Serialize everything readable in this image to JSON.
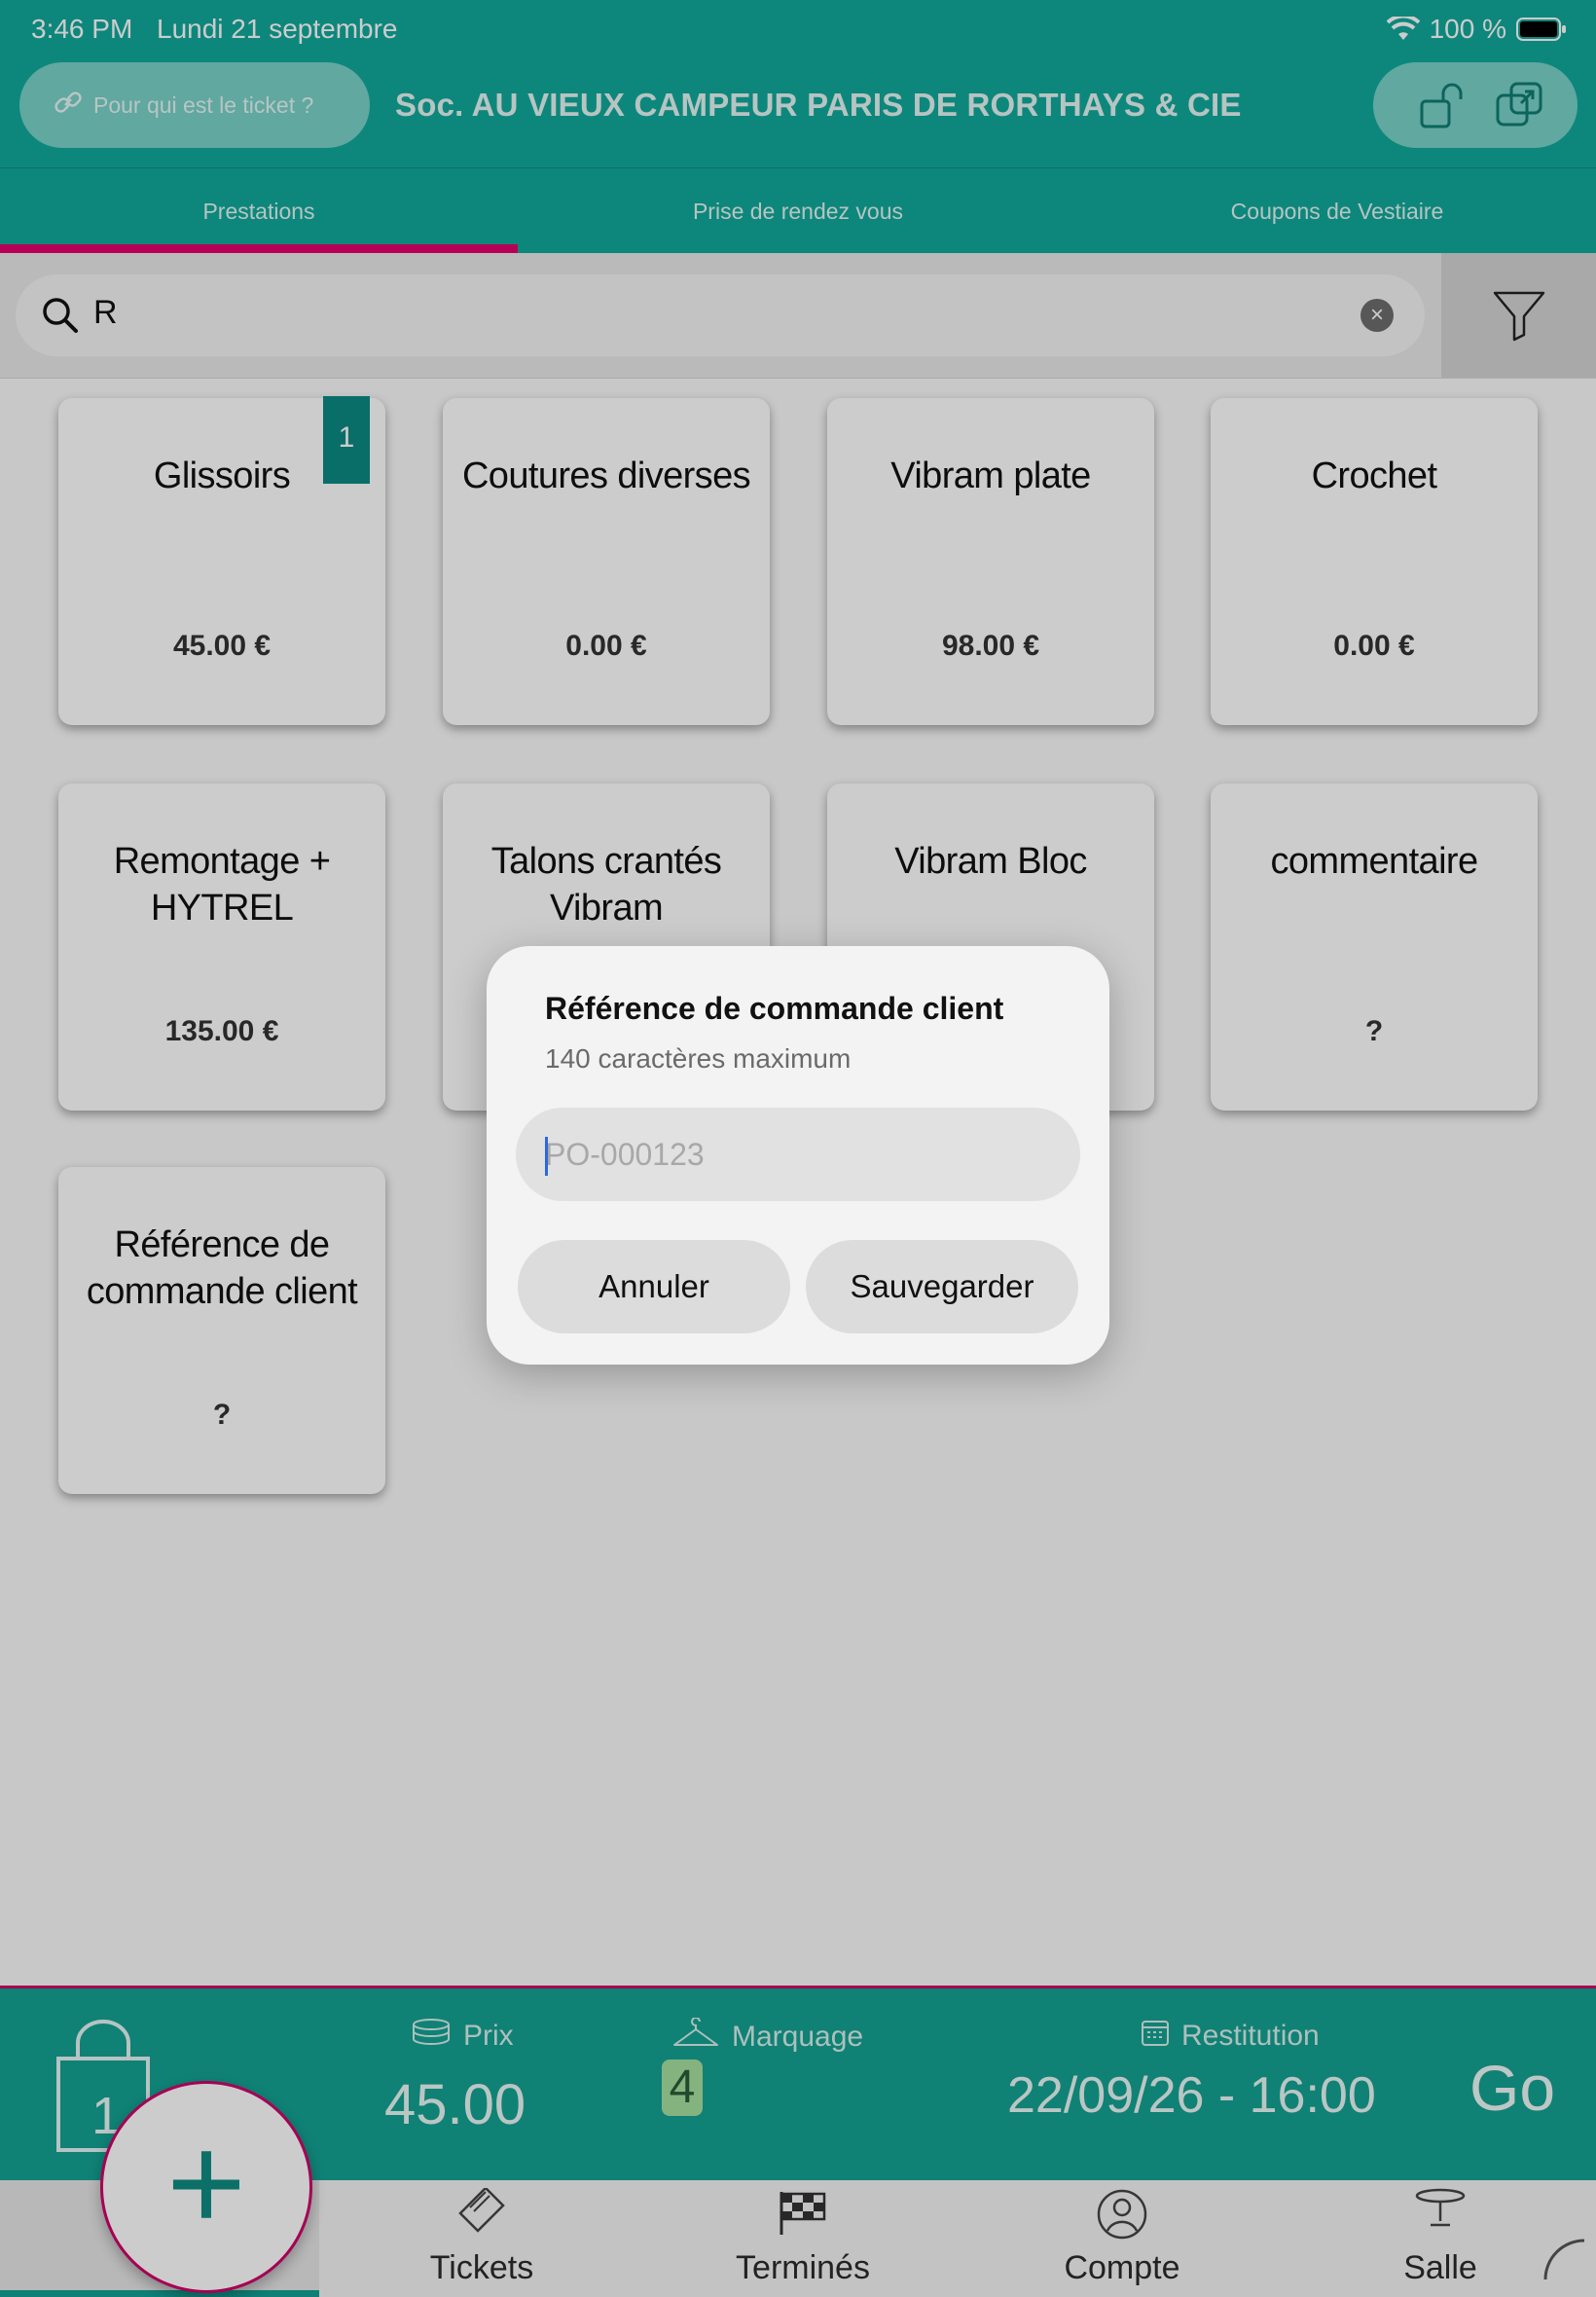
{
  "status_bar": {
    "time": "3:46 PM",
    "date": "Lundi 21 septembre",
    "battery": "100 %"
  },
  "header": {
    "ticket_placeholder": "Pour qui est le ticket ?",
    "company": "Soc. AU VIEUX CAMPEUR PARIS DE RORTHAYS & CIE"
  },
  "tabs": [
    {
      "label": "Prestations",
      "active": true
    },
    {
      "label": "Prise de rendez vous",
      "active": false
    },
    {
      "label": "Coupons de Vestiaire",
      "active": false
    }
  ],
  "search": {
    "value": "R"
  },
  "cards": [
    {
      "name": "Glissoirs",
      "price": "45.00 €",
      "badge": "1"
    },
    {
      "name": "Coutures diverses",
      "price": "0.00 €"
    },
    {
      "name": "Vibram plate",
      "price": "98.00 €"
    },
    {
      "name": "Crochet",
      "price": "0.00 €"
    },
    {
      "name": "Remontage + HYTREL",
      "price": "135.00 €"
    },
    {
      "name": "Talons crantés Vibram",
      "price": ""
    },
    {
      "name": "Vibram Bloc",
      "price": ""
    },
    {
      "name": "commentaire",
      "price": "?"
    },
    {
      "name": "Référence de commande client",
      "price": "?"
    }
  ],
  "summary": {
    "bag_count": "1",
    "price_label": "Prix",
    "price_value": "45.00",
    "marquage_label": "Marquage",
    "marquage_value": "4",
    "restitution_label": "Restitution",
    "restitution_value": "22/09/26 -  16:00",
    "go_label": "Go"
  },
  "nav": {
    "tickets": "Tickets",
    "termines": "Terminés",
    "compte": "Compte",
    "salle": "Salle",
    "fab": "+"
  },
  "dialog": {
    "title": "Référence de commande client",
    "subtitle": "140 caractères maximum",
    "input_placeholder": "PO-000123",
    "cancel": "Annuler",
    "save": "Sauvegarder"
  },
  "colors": {
    "teal": "#11a99b",
    "accent": "#e5006b",
    "badge": "#0d8a82"
  }
}
